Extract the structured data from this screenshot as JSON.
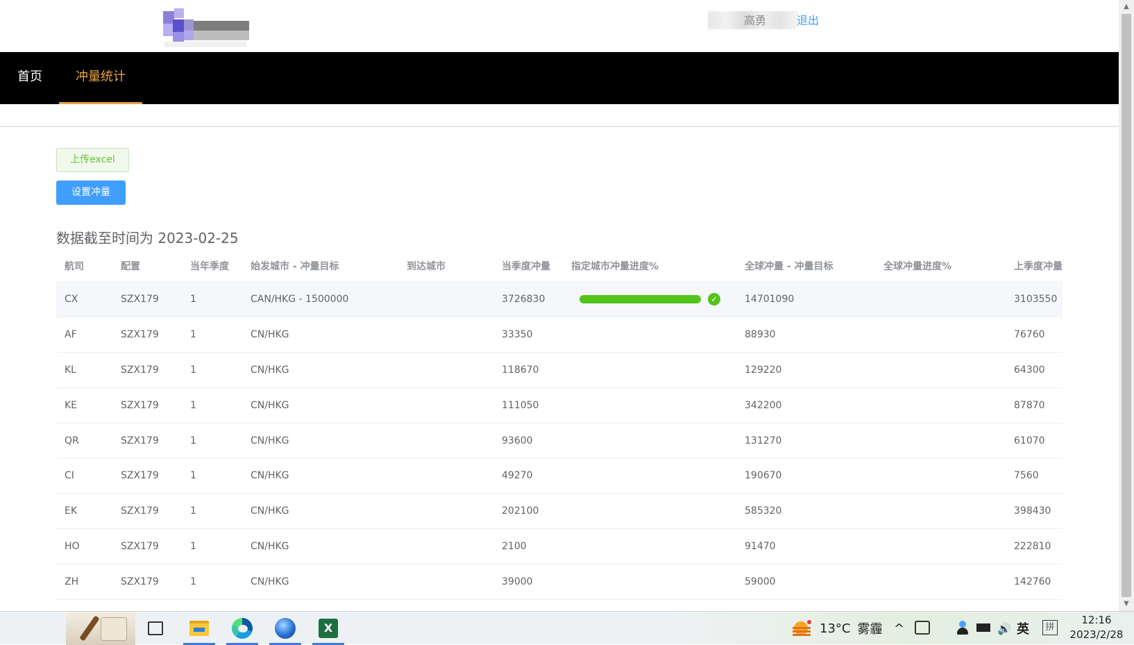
{
  "header": {
    "user_name": "高勇",
    "logout_label": "退出"
  },
  "nav": {
    "items": [
      {
        "label": "首页"
      },
      {
        "label": "冲量统计",
        "active": true
      }
    ]
  },
  "actions": {
    "upload_label": "上传excel",
    "set_label": "设置冲量"
  },
  "data_date": "数据截至时间为 2023-02-25",
  "table": {
    "columns": [
      "航司",
      "配置",
      "当年季度",
      "始发城市 - 冲量目标",
      "到达城市",
      "当季度冲量",
      "指定城市冲量进度%",
      "全球冲量 - 冲量目标",
      "全球冲量进度%",
      "上季度冲量"
    ],
    "rows": [
      {
        "airline": "CX",
        "config": "SZX179",
        "quarter": "1",
        "origin": "CAN/HKG - 1500000",
        "dest": "",
        "qty": "3726830",
        "progress": 1.0,
        "global": "14701090",
        "global_progress": "",
        "last": "3103550"
      },
      {
        "airline": "AF",
        "config": "SZX179",
        "quarter": "1",
        "origin": "CN/HKG",
        "dest": "",
        "qty": "33350",
        "progress": null,
        "global": "88930",
        "global_progress": "",
        "last": "76760"
      },
      {
        "airline": "KL",
        "config": "SZX179",
        "quarter": "1",
        "origin": "CN/HKG",
        "dest": "",
        "qty": "118670",
        "progress": null,
        "global": "129220",
        "global_progress": "",
        "last": "64300"
      },
      {
        "airline": "KE",
        "config": "SZX179",
        "quarter": "1",
        "origin": "CN/HKG",
        "dest": "",
        "qty": "111050",
        "progress": null,
        "global": "342200",
        "global_progress": "",
        "last": "87870"
      },
      {
        "airline": "QR",
        "config": "SZX179",
        "quarter": "1",
        "origin": "CN/HKG",
        "dest": "",
        "qty": "93600",
        "progress": null,
        "global": "131270",
        "global_progress": "",
        "last": "61070"
      },
      {
        "airline": "CI",
        "config": "SZX179",
        "quarter": "1",
        "origin": "CN/HKG",
        "dest": "",
        "qty": "49270",
        "progress": null,
        "global": "190670",
        "global_progress": "",
        "last": "7560"
      },
      {
        "airline": "EK",
        "config": "SZX179",
        "quarter": "1",
        "origin": "CN/HKG",
        "dest": "",
        "qty": "202100",
        "progress": null,
        "global": "585320",
        "global_progress": "",
        "last": "398430"
      },
      {
        "airline": "HO",
        "config": "SZX179",
        "quarter": "1",
        "origin": "CN/HKG",
        "dest": "",
        "qty": "2100",
        "progress": null,
        "global": "91470",
        "global_progress": "",
        "last": "222810"
      },
      {
        "airline": "ZH",
        "config": "SZX179",
        "quarter": "1",
        "origin": "CN/HKG",
        "dest": "",
        "qty": "39000",
        "progress": null,
        "global": "59000",
        "global_progress": "",
        "last": "142760"
      }
    ]
  },
  "taskbar": {
    "weather_temp": "13°C",
    "weather_desc": "雾霾",
    "caret": "^",
    "volume": "🔊",
    "lang": "英",
    "ime": "拼",
    "time": "12:16",
    "date": "2023/2/28",
    "excel_glyph": "X"
  },
  "colors": {
    "nav_bg": "#000000",
    "nav_active": "#e6a23c",
    "primary": "#409eff",
    "success": "#67c23a",
    "progress": "#52c41a"
  }
}
